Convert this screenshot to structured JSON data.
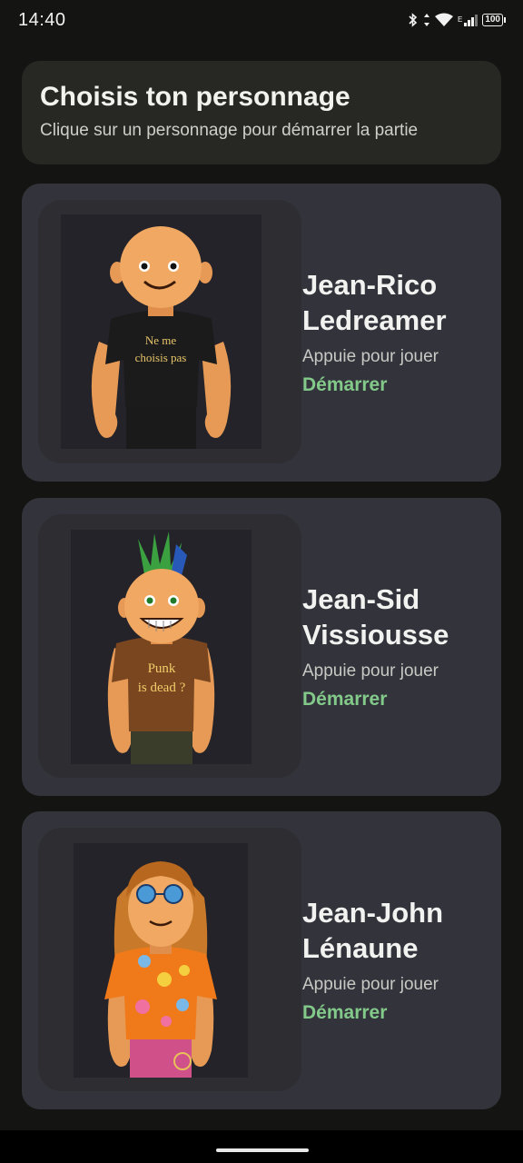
{
  "status_bar": {
    "time": "14:40",
    "battery": "100",
    "icons": [
      "bluetooth-icon",
      "data-arrows-icon",
      "wifi-icon",
      "signal-icon",
      "battery-icon"
    ]
  },
  "header": {
    "title": "Choisis ton personnage",
    "subtitle": "Clique sur un personnage pour démarrer la partie"
  },
  "characters": [
    {
      "name_line1": "Jean-Rico",
      "name_line2": "Ledreamer",
      "hint": "Appuie pour jouer",
      "action": "Démarrer",
      "shirt_text_line1": "Ne me",
      "shirt_text_line2": "choisis pas"
    },
    {
      "name_line1": "Jean-Sid",
      "name_line2": "Vissiousse",
      "hint": "Appuie pour jouer",
      "action": "Démarrer",
      "shirt_text_line1": "Punk",
      "shirt_text_line2": "is dead ?"
    },
    {
      "name_line1": "Jean-John",
      "name_line2": "Lénaune",
      "hint": "Appuie pour jouer",
      "action": "Démarrer",
      "shirt_text_line1": "",
      "shirt_text_line2": ""
    }
  ],
  "colors": {
    "background": "#141412",
    "card": "#33333b",
    "header_card": "#272824",
    "accent_green": "#82c98a"
  }
}
